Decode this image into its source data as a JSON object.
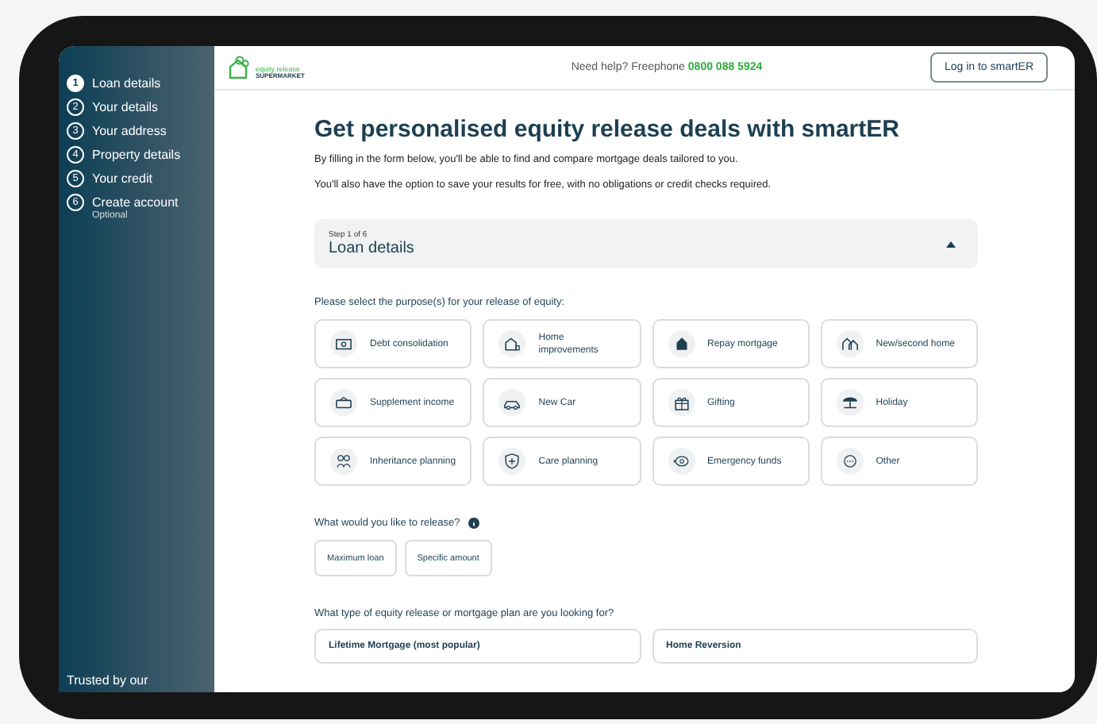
{
  "sidebar": {
    "steps": [
      {
        "number": "1",
        "label": "Loan details",
        "selected": true
      },
      {
        "number": "2",
        "label": "Your details",
        "selected": false
      },
      {
        "number": "3",
        "label": "Your address",
        "selected": false
      },
      {
        "number": "4",
        "label": "Property details",
        "selected": false
      },
      {
        "number": "5",
        "label": "Your credit",
        "selected": false
      },
      {
        "number": "6",
        "label": "Create account",
        "sublabel": "Optional",
        "selected": false
      }
    ],
    "footer_text": "Trusted by our"
  },
  "header": {
    "logo_text": "equity release",
    "logo_subtext": "SUPERMARKET",
    "help_text": "Need help? Freephone",
    "phone": "0800 088 5924",
    "login_button": "Log in to smartER"
  },
  "intro": {
    "title": "Get personalised equity release deals with smartER",
    "paragraphs": [
      "By filling in the form below, you'll be able to find and compare mortgage deals tailored to you.",
      "You'll also have the option to save your results for free, with no obligations or credit checks required."
    ]
  },
  "step_panel": {
    "step_label": "Step 1 of 6",
    "title": "Loan details",
    "expanded": true
  },
  "purposes": {
    "question": "Please select the purpose(s) for your release of equity:",
    "options": [
      {
        "label": "Debt consolidation",
        "selected": false
      },
      {
        "label": "Home improvements",
        "selected": false
      },
      {
        "label": "Repay mortgage",
        "selected": false
      },
      {
        "label": "New/second home",
        "selected": false
      },
      {
        "label": "Supplement income",
        "selected": false
      },
      {
        "label": "New Car",
        "selected": false
      },
      {
        "label": "Gifting",
        "selected": false
      },
      {
        "label": "Holiday",
        "selected": false
      },
      {
        "label": "Inheritance planning",
        "selected": false
      },
      {
        "label": "Care planning",
        "selected": false
      },
      {
        "label": "Emergency funds",
        "selected": false
      },
      {
        "label": "Other",
        "selected": false
      }
    ]
  },
  "release": {
    "question": "What would you like to release?",
    "options": [
      {
        "label": "Maximum loan",
        "selected": false
      },
      {
        "label": "Specific amount",
        "selected": false
      }
    ]
  },
  "plan": {
    "question": "What type of equity release or mortgage plan are you looking for?",
    "options": [
      {
        "label": "Lifetime Mortgage (most popular)",
        "selected": false
      },
      {
        "label": "Home Reversion",
        "selected": false
      }
    ]
  }
}
